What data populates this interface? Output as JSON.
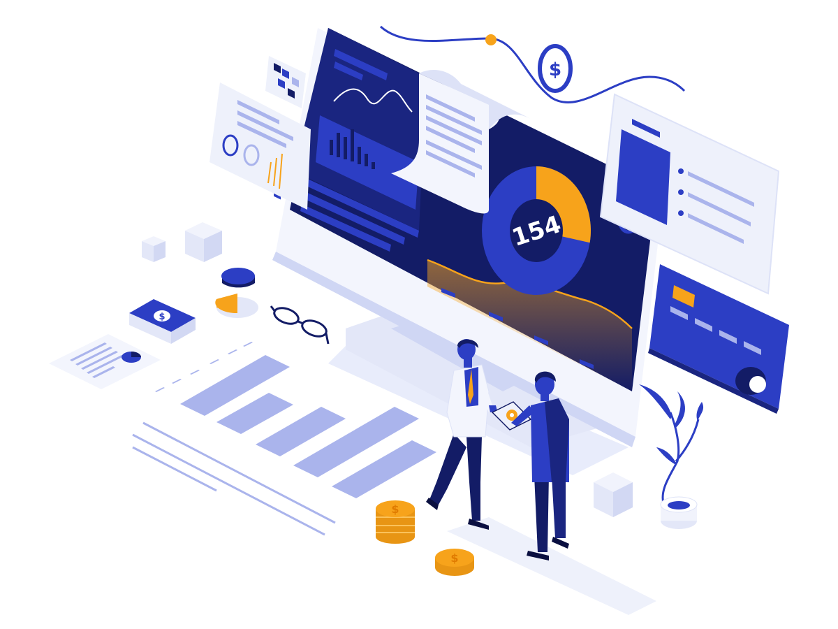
{
  "dashboard": {
    "donut_value": "154",
    "donut_fraction": 0.28
  },
  "symbols": {
    "currency": "$",
    "money_sign": "$"
  },
  "colors": {
    "navy": "#131c66",
    "blue": "#2c3ec4",
    "light_blue": "#aab4ec",
    "pale": "#eef1fb",
    "orange": "#f7a31b",
    "white": "#ffffff"
  },
  "icons": {
    "coins": "coin-stack-icon",
    "plant": "plant-icon",
    "glasses": "glasses-icon",
    "card": "credit-card-icon",
    "banknote": "banknote-icon"
  }
}
